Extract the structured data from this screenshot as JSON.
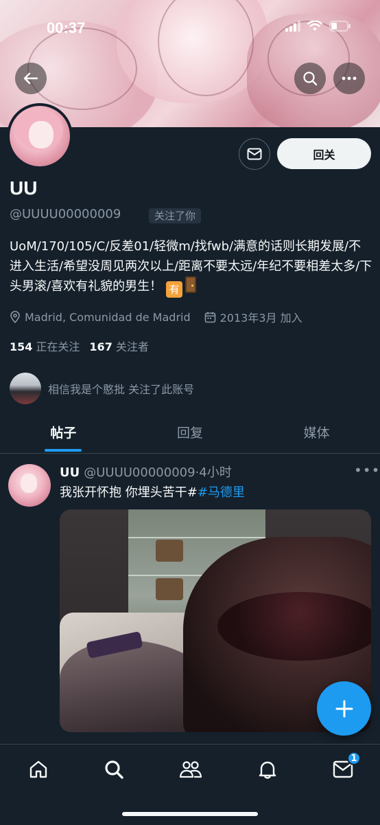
{
  "status_bar": {
    "time": "00:37"
  },
  "profile": {
    "name": "UU",
    "handle": "@UUUU00000009",
    "follows_you": "关注了你",
    "follow_back_label": "回关",
    "bio": "UoM/170/105/C/反差01/轻微m/找fwb/满意的话则长期发展/不进入生活/希望没周见两次以上/距离不要太远/年纪不要相差太多/下头男滚/喜欢有礼貌的男生！",
    "bio_emoji_you": "有",
    "location": "Madrid, Comunidad de Madrid",
    "joined": "2013年3月 加入",
    "following_count": "154",
    "following_label": "正在关注",
    "followers_count": "167",
    "followers_label": "关注者",
    "followed_by": "相信我是个憨批 关注了此账号"
  },
  "tabs": [
    {
      "label": "帖子",
      "active": true
    },
    {
      "label": "回复",
      "active": false
    },
    {
      "label": "媒体",
      "active": false
    }
  ],
  "post": {
    "name": "UU",
    "handle_time": "@UUUU00000009·4小时",
    "text": "我张开怀抱  你埋头苦干#",
    "hashtag": "#马德里",
    "more": "•••"
  },
  "bottom_nav": {
    "items": [
      "home-icon",
      "search-icon",
      "communities-icon",
      "notifications-icon",
      "messages-icon"
    ],
    "messages_badge": "1"
  },
  "colors": {
    "accent": "#1d9bf0",
    "background": "#15202b",
    "muted": "#8b98a5"
  }
}
